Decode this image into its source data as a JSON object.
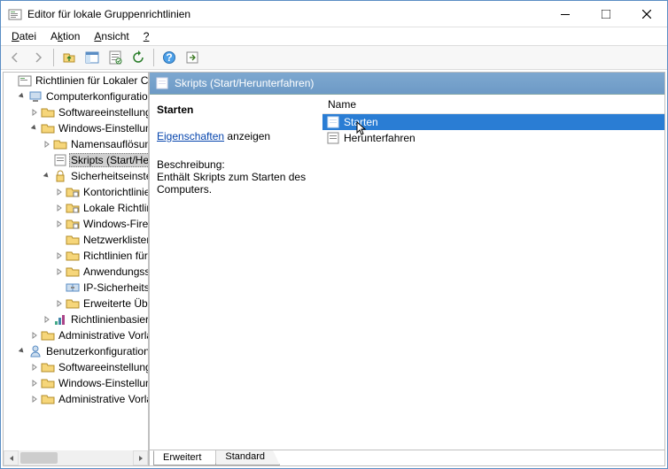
{
  "titlebar": {
    "title": "Editor für lokale Gruppenrichtlinien"
  },
  "menu": {
    "file": "Datei",
    "action": "Aktion",
    "view": "Ansicht",
    "help": "?"
  },
  "tree": {
    "root": "Richtlinien für Lokaler Computer",
    "computerconfig": "Computerkonfiguration",
    "software1": "Softwareeinstellungen",
    "windows1": "Windows-Einstellungen",
    "nameres": "Namensauflösung",
    "scripts": "Skripts (Start/Herunterfahren)",
    "security": "Sicherheitseinstellungen",
    "account": "Kontorichtlinien",
    "local": "Lokale Richtlinien",
    "winfw": "Windows-Firewall",
    "netlist": "Netzwerklisten",
    "pubkey": "Richtlinien für öffentliche Schlüssel",
    "apprestrict": "Anwendungssteuerung",
    "ipsec": "IP-Sicherheitsrichtlinien",
    "advanced": "Erweiterte Überwachungsrichtlinien",
    "policybased": "Richtlinienbasierter QoS",
    "admin1": "Administrative Vorlagen",
    "userconfig": "Benutzerkonfiguration",
    "software2": "Softwareeinstellungen",
    "windows2": "Windows-Einstellungen",
    "admin2": "Administrative Vorlagen"
  },
  "content": {
    "header": "Skripts (Start/Herunterfahren)",
    "selected": "Starten",
    "props_link": "Eigenschaften",
    "props_suffix": " anzeigen",
    "descr_label": "Beschreibung:",
    "descr_text": "Enthält Skripts zum Starten des Computers.",
    "col_name": "Name",
    "items": [
      "Starten",
      "Herunterfahren"
    ]
  },
  "tabs": {
    "ext": "Erweitert",
    "std": "Standard"
  }
}
